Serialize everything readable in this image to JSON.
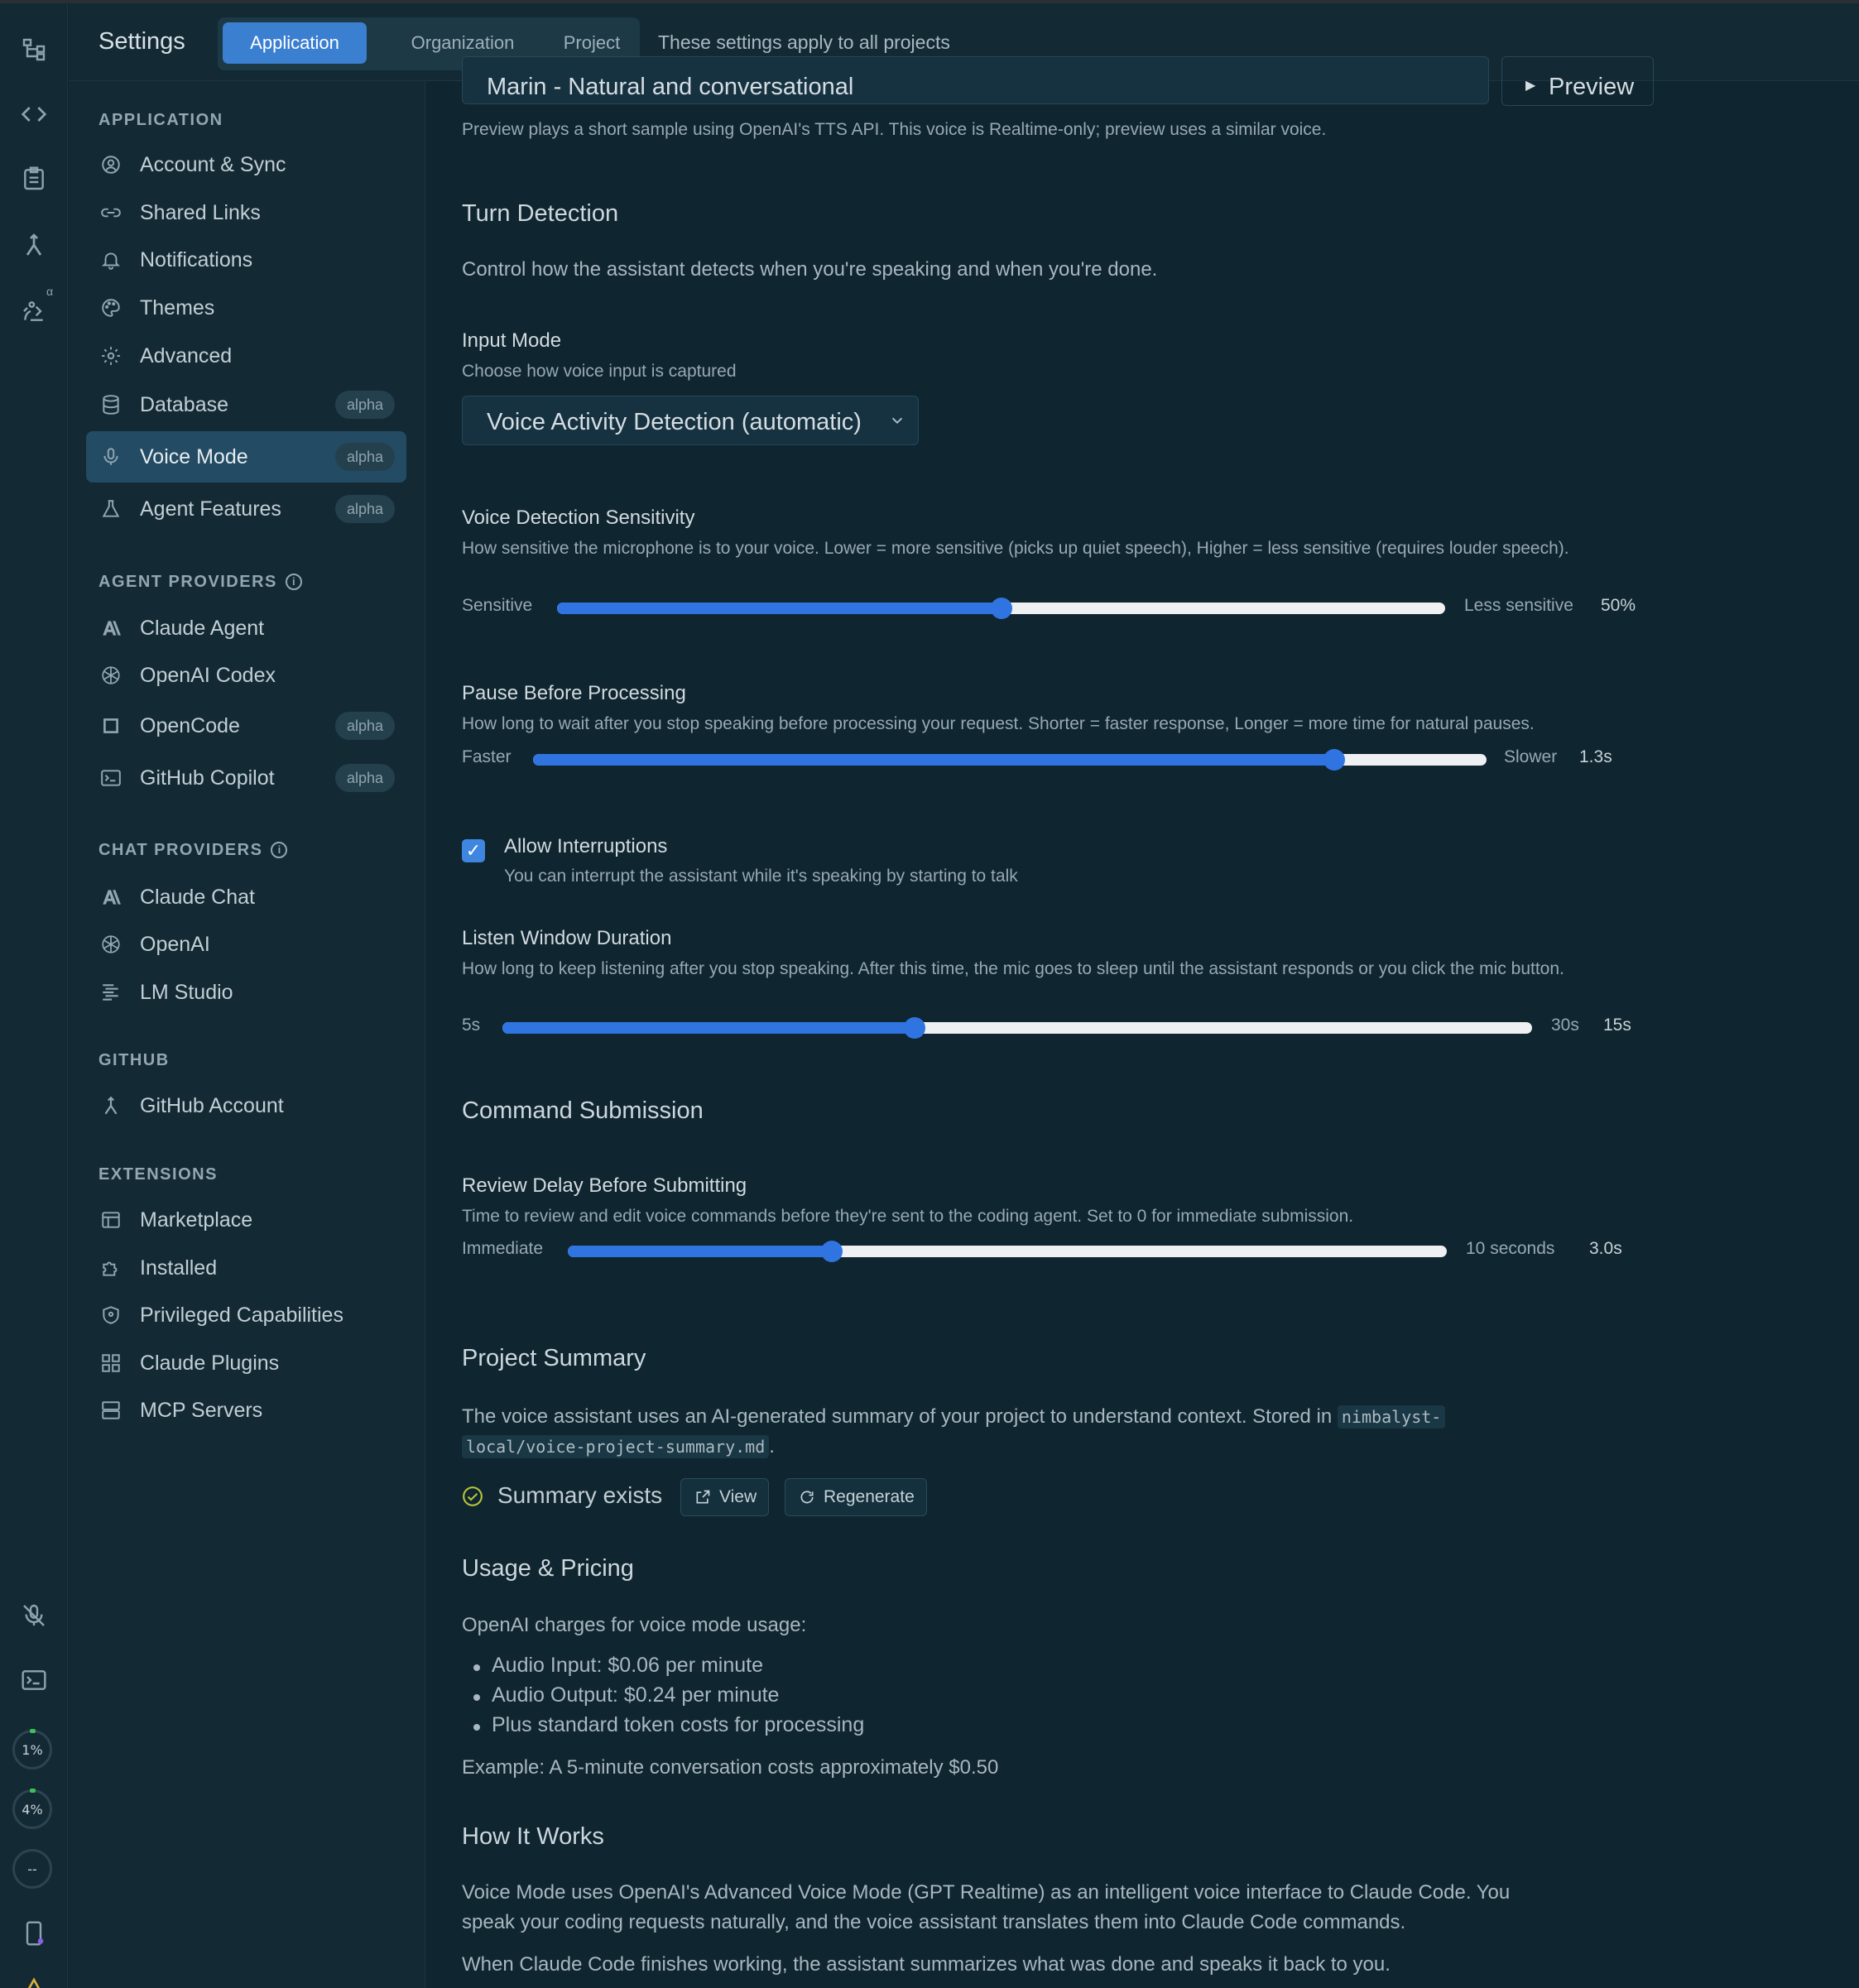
{
  "header": {
    "title": "Settings",
    "tabs": [
      {
        "label": "Application",
        "active": true
      },
      {
        "label": "Organization",
        "active": false
      },
      {
        "label": "Project",
        "active": false
      }
    ],
    "scope_note": "These settings apply to all projects"
  },
  "rail": {
    "alpha_marker": "α",
    "usage": [
      {
        "label": "1%"
      },
      {
        "label": "4%"
      },
      {
        "label": "--"
      }
    ]
  },
  "sidebar": {
    "sections": [
      {
        "heading": "APPLICATION",
        "items": [
          {
            "label": "Account & Sync",
            "icon": "user-circle-icon"
          },
          {
            "label": "Shared Links",
            "icon": "link-icon"
          },
          {
            "label": "Notifications",
            "icon": "bell-icon"
          },
          {
            "label": "Themes",
            "icon": "palette-icon"
          },
          {
            "label": "Advanced",
            "icon": "gear-icon"
          },
          {
            "label": "Database",
            "icon": "database-icon",
            "badge": "alpha"
          },
          {
            "label": "Voice Mode",
            "icon": "microphone-icon",
            "badge": "alpha",
            "active": true
          },
          {
            "label": "Agent Features",
            "icon": "flask-icon",
            "badge": "alpha"
          }
        ]
      },
      {
        "heading": "AGENT PROVIDERS",
        "items": [
          {
            "label": "Claude Agent",
            "icon": "anthropic-icon"
          },
          {
            "label": "OpenAI Codex",
            "icon": "openai-icon"
          },
          {
            "label": "OpenCode",
            "icon": "square-icon",
            "badge": "alpha"
          },
          {
            "label": "GitHub Copilot",
            "icon": "terminal-icon",
            "badge": "alpha"
          }
        ]
      },
      {
        "heading": "CHAT PROVIDERS",
        "items": [
          {
            "label": "Claude Chat",
            "icon": "anthropic-icon"
          },
          {
            "label": "OpenAI",
            "icon": "openai-icon"
          },
          {
            "label": "LM Studio",
            "icon": "lm-studio-icon"
          }
        ]
      },
      {
        "heading": "GITHUB",
        "items": [
          {
            "label": "GitHub Account",
            "icon": "git-merge-icon"
          }
        ]
      },
      {
        "heading": "EXTENSIONS",
        "items": [
          {
            "label": "Marketplace",
            "icon": "store-icon"
          },
          {
            "label": "Installed",
            "icon": "puzzle-icon"
          },
          {
            "label": "Privileged Capabilities",
            "icon": "shield-icon"
          },
          {
            "label": "Claude Plugins",
            "icon": "grid-icon"
          },
          {
            "label": "MCP Servers",
            "icon": "server-icon"
          }
        ]
      }
    ]
  },
  "voice": {
    "selected_voice": "Marin - Natural and conversational",
    "preview_label": "Preview",
    "preview_note": "Preview plays a short sample using OpenAI's TTS API. This voice is Realtime-only; preview uses a similar voice."
  },
  "turn_detection": {
    "heading": "Turn Detection",
    "description": "Control how the assistant detects when you're speaking and when you're done.",
    "input_mode": {
      "label": "Input Mode",
      "hint": "Choose how voice input is captured",
      "value": "Voice Activity Detection (automatic)"
    },
    "sensitivity": {
      "label": "Voice Detection Sensitivity",
      "hint": "How sensitive the microphone is to your voice. Lower = more sensitive (picks up quiet speech), Higher = less sensitive (requires louder speech).",
      "low": "Sensitive",
      "high": "Less sensitive",
      "display": "50%",
      "fraction": 0.5
    },
    "pause": {
      "label": "Pause Before Processing",
      "hint": "How long to wait after you stop speaking before processing your request. Shorter = faster response, Longer = more time for natural pauses.",
      "low": "Faster",
      "high": "Slower",
      "display": "1.3s",
      "fraction": 0.84
    },
    "interruptions": {
      "label": "Allow Interruptions",
      "hint": "You can interrupt the assistant while it's speaking by starting to talk",
      "checked": true
    },
    "listen_window": {
      "label": "Listen Window Duration",
      "hint": "How long to keep listening after you stop speaking. After this time, the mic goes to sleep until the assistant responds or you click the mic button.",
      "low": "5s",
      "high": "30s",
      "display": "15s",
      "fraction": 0.4
    }
  },
  "command_submission": {
    "heading": "Command Submission",
    "review_delay": {
      "label": "Review Delay Before Submitting",
      "hint": "Time to review and edit voice commands before they're sent to the coding agent. Set to 0 for immediate submission.",
      "low": "Immediate",
      "high": "10 seconds",
      "display": "3.0s",
      "fraction": 0.3
    }
  },
  "project_summary": {
    "heading": "Project Summary",
    "text_before": "The voice assistant uses an AI-generated summary of your project to understand context. Stored in ",
    "path_line1": "nimbalyst-",
    "path_line2": "local/voice-project-summary.md",
    "text_after": ".",
    "status": "Summary exists",
    "view_label": "View",
    "regenerate_label": "Regenerate"
  },
  "usage_pricing": {
    "heading": "Usage & Pricing",
    "intro": "OpenAI charges for voice mode usage:",
    "items": [
      "Audio Input: $0.06 per minute",
      "Audio Output: $0.24 per minute",
      "Plus standard token costs for processing"
    ],
    "example": "Example: A 5-minute conversation costs approximately $0.50"
  },
  "how_it_works": {
    "heading": "How It Works",
    "para1_line1": "Voice Mode uses OpenAI's Advanced Voice Mode (GPT Realtime) as an intelligent voice interface to Claude Code. You",
    "para1_line2": "speak your coding requests naturally, and the voice assistant translates them into Claude Code commands.",
    "para2": "When Claude Code finishes working, the assistant summarizes what was done and speaks it back to you."
  },
  "colors": {
    "accent": "#3b7fd1",
    "slider_fill": "#2f74e0",
    "background": "#0f2530",
    "sidebar_bg": "#132a35",
    "success": "#b5c23a"
  }
}
